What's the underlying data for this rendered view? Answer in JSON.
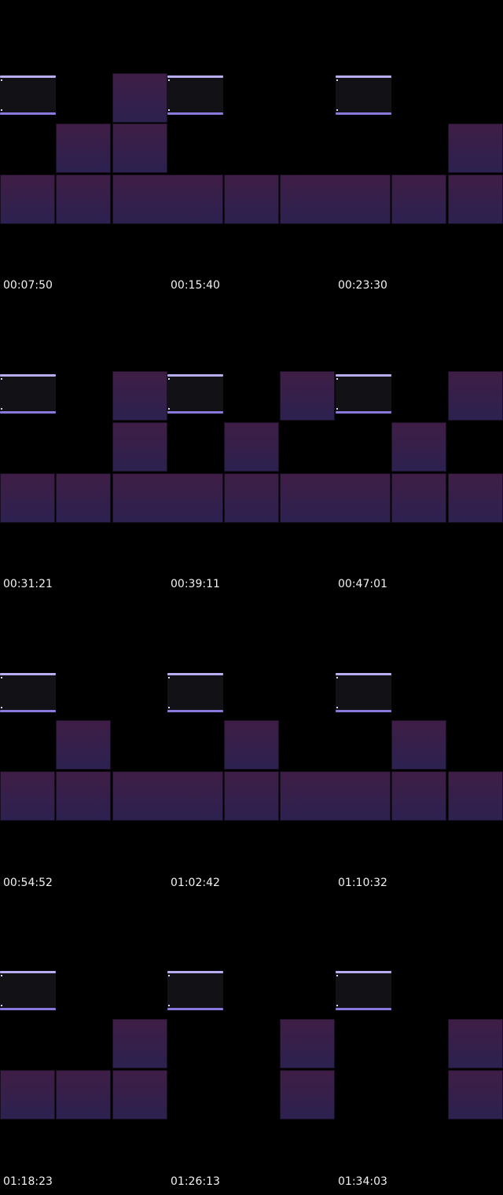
{
  "colors": {
    "background": "#000000",
    "tile_top": "#3f1e45",
    "tile_bottom": "#2c2150",
    "panel_fill": "#111116",
    "panel_bar_top": "#b6aef0",
    "panel_bar_bottom": "#8a79dc",
    "timestamp_text": "#f2f2f2"
  },
  "frames": [
    {
      "timestamps": [
        "00:07:50",
        "00:15:40",
        "00:23:30"
      ]
    },
    {
      "timestamps": [
        "00:31:21",
        "00:39:11",
        "00:47:01"
      ]
    },
    {
      "timestamps": [
        "00:54:52",
        "01:02:42",
        "01:10:32"
      ]
    },
    {
      "timestamps": [
        "01:18:23",
        "01:26:13",
        "01:34:03"
      ]
    }
  ]
}
